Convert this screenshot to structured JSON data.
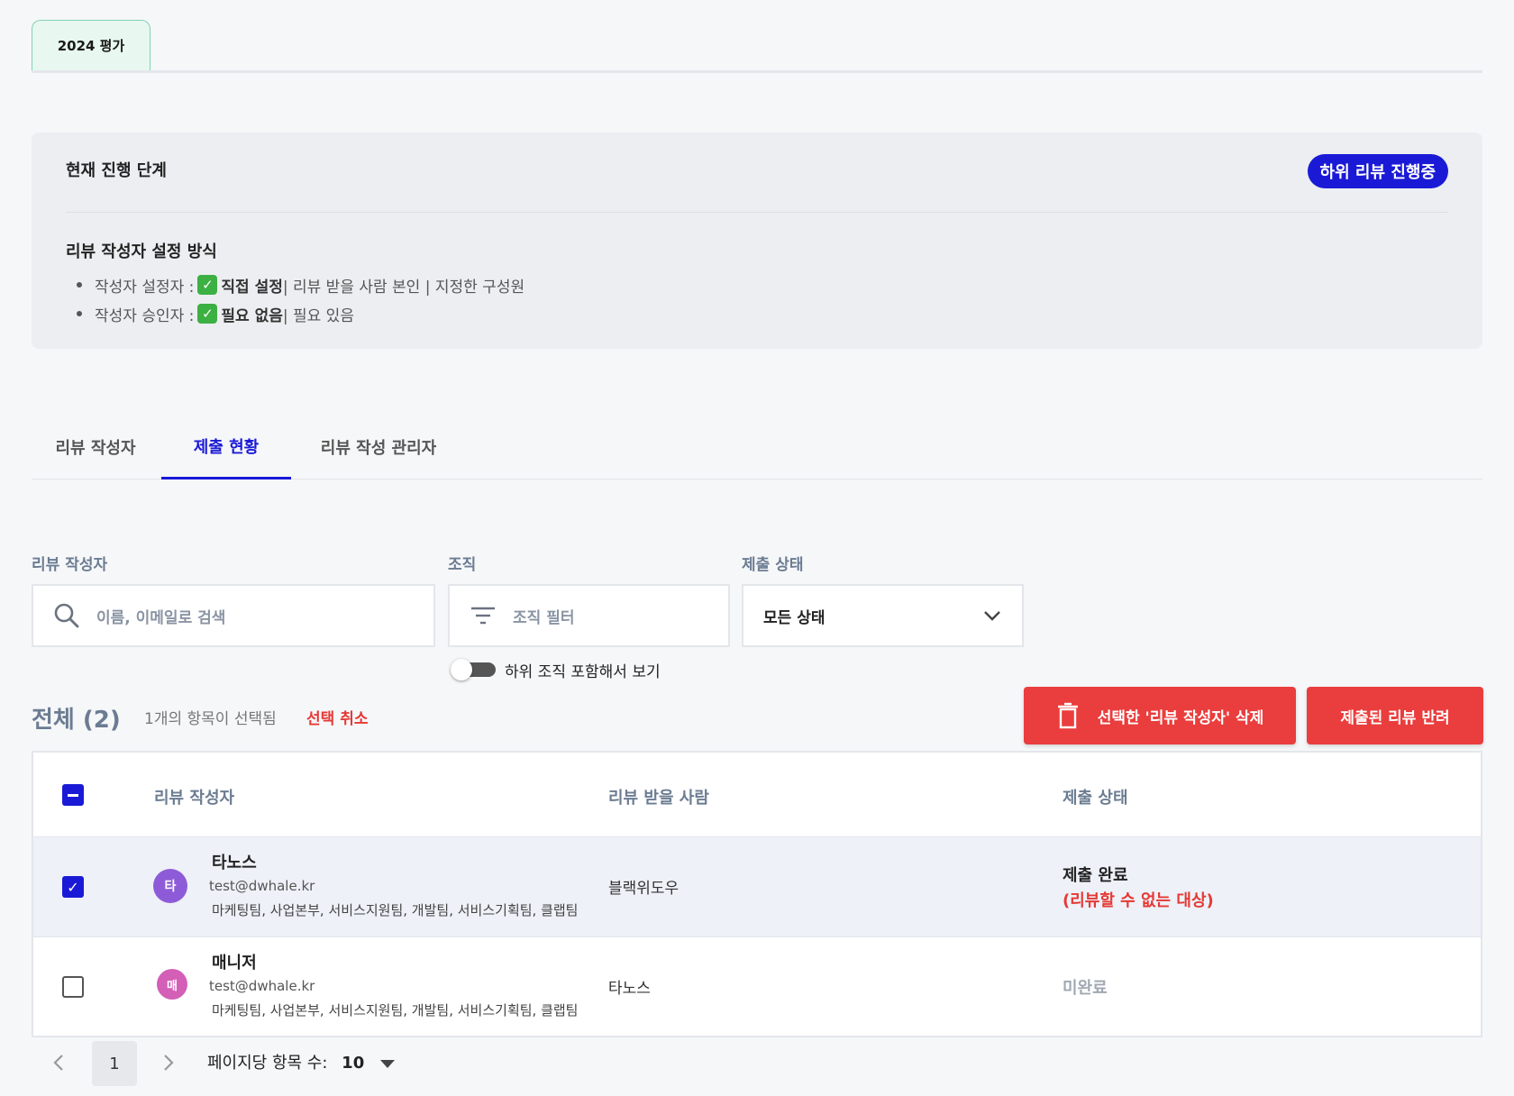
{
  "top_tab": {
    "label": "2024 평가"
  },
  "panel": {
    "title": "현재 진행 단계",
    "badge": "하위 리뷰 진행중",
    "subtitle": "리뷰 작성자 설정 방식",
    "items": [
      {
        "label": "작성자 설정자 : ",
        "selected": "직접 설정",
        "rest": " | 리뷰 받을 사람 본인 | 지정한 구성원"
      },
      {
        "label": "작성자 승인자 : ",
        "selected": "필요 없음",
        "rest": " | 필요 있음"
      }
    ]
  },
  "tabs": [
    {
      "label": "리뷰 작성자",
      "active": false
    },
    {
      "label": "제출 현황",
      "active": true
    },
    {
      "label": "리뷰 작성 관리자",
      "active": false
    }
  ],
  "filters": {
    "writer_label": "리뷰 작성자",
    "writer_placeholder": "이름, 이메일로 검색",
    "org_label": "조직",
    "org_placeholder": "조직 필터",
    "status_label": "제출 상태",
    "status_value": "모든 상태",
    "toggle_label": "하위 조직 포함해서 보기"
  },
  "summary": {
    "total": "전체 (2)",
    "selected_count": "1개의 항목이 선택됨",
    "cancel_selection": "선택 취소",
    "delete_button": "선택한 '리뷰 작성자' 삭제",
    "return_button": "제출된 리뷰 반려"
  },
  "table": {
    "headers": [
      "리뷰 작성자",
      "리뷰 받을 사람",
      "제출 상태"
    ],
    "rows": [
      {
        "checked": true,
        "avatar": "타",
        "avatar_color": "#8e5bd8",
        "name": "타노스",
        "email": "test@dwhale.kr",
        "org": "마케팅팀, 사업본부, 서비스지원팀, 개발팀, 서비스기획팀, 클랩팀",
        "reviewee": "블랙위도우",
        "status": "제출 완료",
        "status_note": "(리뷰할 수 없는 대상)"
      },
      {
        "checked": false,
        "avatar": "매",
        "avatar_color": "#d35fb7",
        "name": "매니저",
        "email": "test@dwhale.kr",
        "org": "마케팅팀, 사업본부, 서비스지원팀, 개발팀, 서비스기획팀, 클랩팀",
        "reviewee": "타노스",
        "status": "미완료",
        "status_note": ""
      }
    ]
  },
  "pagination": {
    "current_page": "1",
    "per_page_label": "페이지당 항목 수:",
    "per_page_value": "10"
  },
  "colors": {
    "accent": "#1a1ad6",
    "danger": "#ea3d3d",
    "muted": "#6b7c92"
  }
}
